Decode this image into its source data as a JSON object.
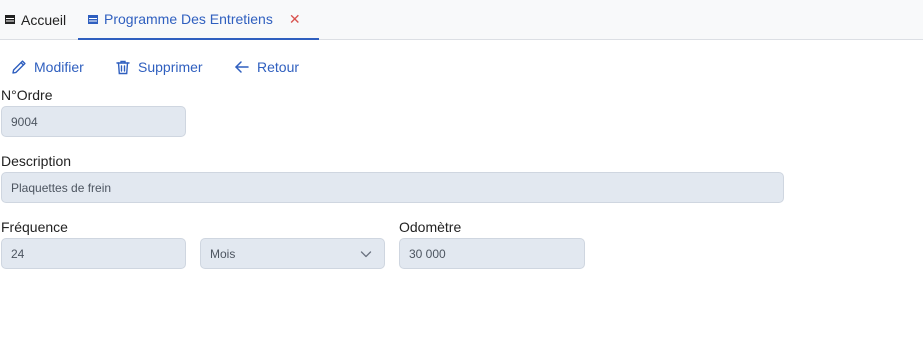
{
  "tabs": {
    "home_label": "Accueil",
    "active_label": "Programme Des Entretiens",
    "close_glyph": "✕"
  },
  "toolbar": {
    "edit_label": "Modifier",
    "delete_label": "Supprimer",
    "back_label": "Retour"
  },
  "form": {
    "order_label": "N°Ordre",
    "order_value": "9004",
    "description_label": "Description",
    "description_value": "Plaquettes de frein",
    "frequency_label": "Fréquence",
    "frequency_value": "24",
    "frequency_unit": "Mois",
    "odometer_label": "Odomètre",
    "odometer_value": "30 000"
  },
  "colors": {
    "accent": "#2f5fbf",
    "field_bg": "#e2e8f0",
    "close": "#d9534f"
  },
  "icons": {
    "tab_home": "table-icon",
    "tab_active": "table-icon",
    "edit": "pencil-icon",
    "delete": "trash-icon",
    "back": "arrow-left-icon",
    "select": "chevron-down-icon"
  }
}
